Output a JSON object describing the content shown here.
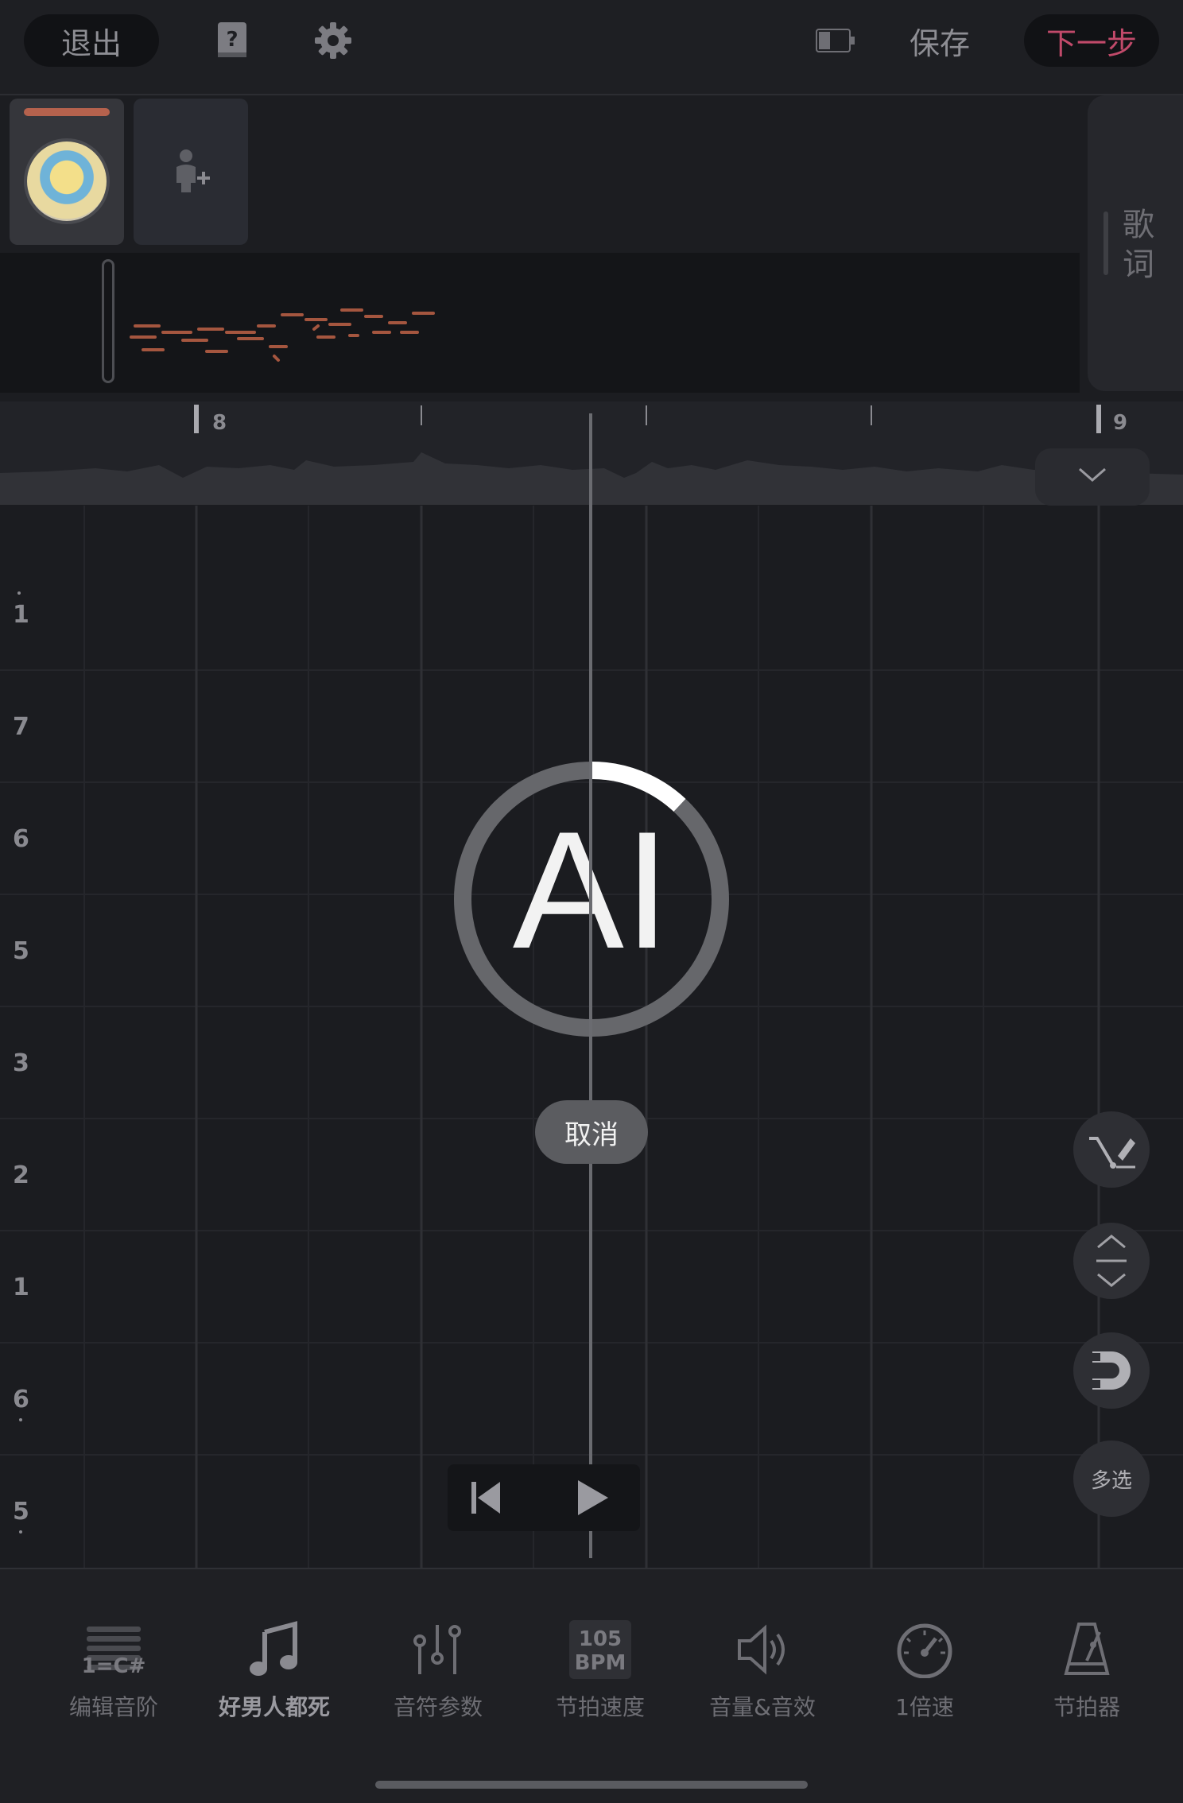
{
  "topbar": {
    "exit_label": "退出",
    "save_label": "保存",
    "next_label": "下一步"
  },
  "tracks": {
    "lyrics_label": "歌词"
  },
  "ruler": {
    "markers": [
      "8",
      "9"
    ]
  },
  "pitch_labels": [
    "1",
    "7",
    "6",
    "5",
    "3",
    "2",
    "1",
    "6",
    "5"
  ],
  "ai_overlay": {
    "text": "AI",
    "progress": 0.12,
    "cancel_label": "取消"
  },
  "tools": {
    "multi_select_label": "多选"
  },
  "bottom_toolbar": {
    "items": [
      {
        "label": "编辑音阶",
        "icon": "scale-icon",
        "icon_text": "1=C#"
      },
      {
        "label": "好男人都死",
        "icon": "music-note-icon"
      },
      {
        "label": "音符参数",
        "icon": "sliders-icon"
      },
      {
        "label": "节拍速度",
        "icon": "bpm-icon",
        "icon_text_top": "105",
        "icon_text_bottom": "BPM"
      },
      {
        "label": "音量&音效",
        "icon": "speaker-icon"
      },
      {
        "label": "1倍速",
        "icon": "speedometer-icon"
      },
      {
        "label": "节拍器",
        "icon": "metronome-icon"
      }
    ]
  },
  "colors": {
    "accent": "#c14a6a",
    "note": "#b5624d",
    "background": "#1b1c20"
  }
}
